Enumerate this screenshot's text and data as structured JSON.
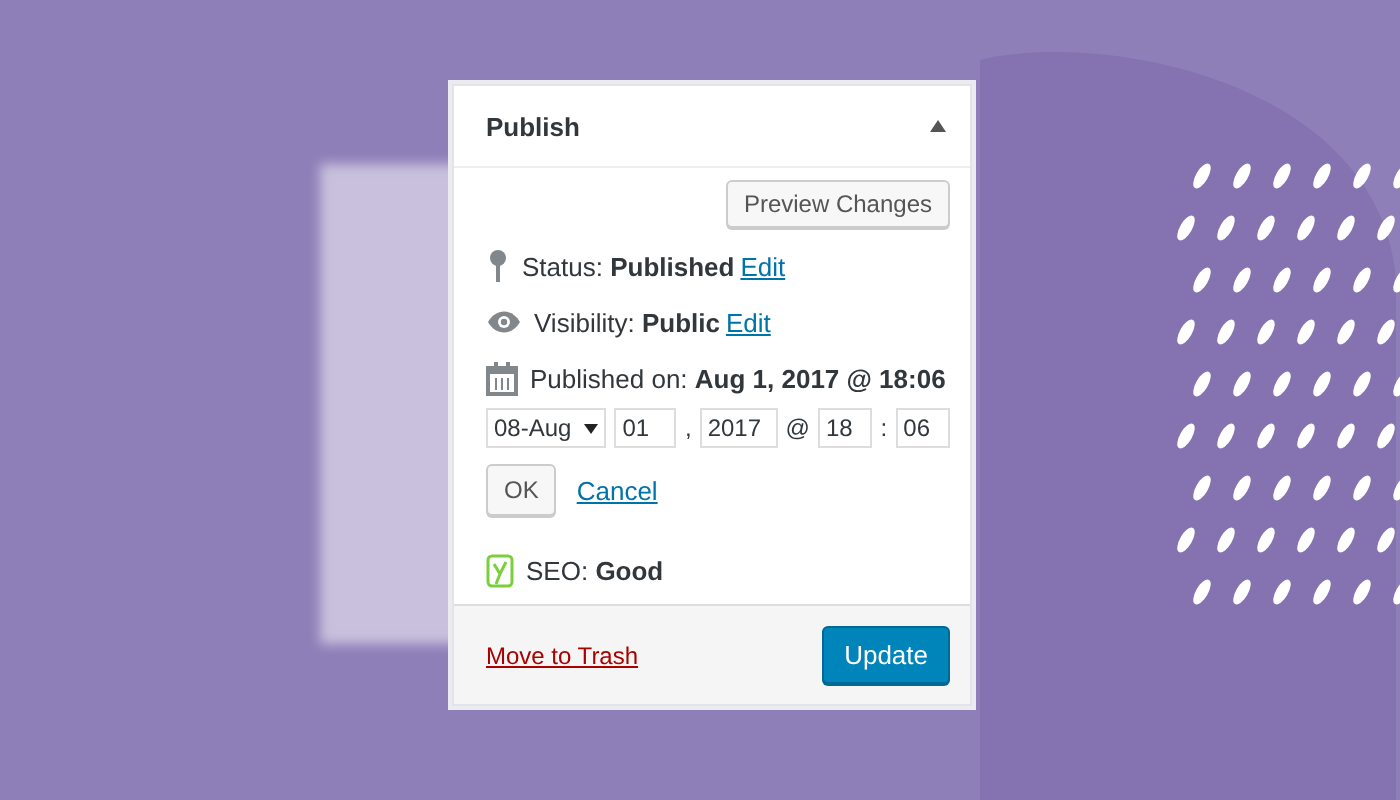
{
  "panel": {
    "title": "Publish",
    "expanded": true,
    "preview_button": "Preview Changes",
    "status": {
      "text": "Status: **Published**",
      "link": "Edit"
    },
    "visibility": {
      "text": "Visibility: **Public**",
      "link": "Edit"
    },
    "published_on": "Published on: **Aug 1, 2017 @ 18:06**",
    "date": {
      "month": "08-Aug",
      "day": "01",
      "comma": ",",
      "year": "2017",
      "at": "@",
      "hour": "18",
      "colon": ":",
      "minute": "06"
    },
    "ok_button": "OK",
    "cancel_link": "Cancel",
    "seo": "SEO: **Good**",
    "trash_link": "Move to Trash",
    "update_button": "Update"
  }
}
